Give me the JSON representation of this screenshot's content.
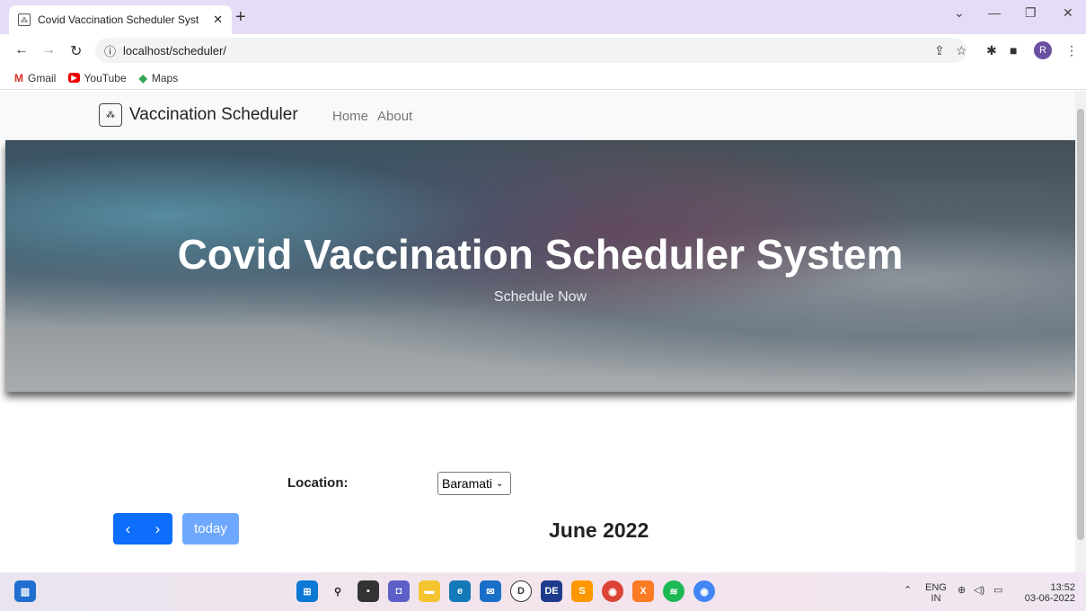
{
  "browser": {
    "tab_title": "Covid Vaccination Scheduler Syst",
    "tab_close": "✕",
    "new_tab": "+",
    "url": "localhost/scheduler/",
    "bookmarks": [
      {
        "label": "Gmail",
        "icon": "M"
      },
      {
        "label": "YouTube",
        "icon": "▶"
      },
      {
        "label": "Maps",
        "icon": "◆"
      }
    ],
    "profile_initial": "R"
  },
  "navbar": {
    "brand": "Vaccination Scheduler",
    "links": [
      "Home",
      "About"
    ]
  },
  "hero": {
    "title": "Covid Vaccination Scheduler System",
    "subtitle": "Schedule Now"
  },
  "form": {
    "location_label": "Location:",
    "location_value": "Baramati"
  },
  "calendar": {
    "prev": "‹",
    "next": "›",
    "today": "today",
    "title": "June 2022"
  },
  "taskbar": {
    "lang_top": "ENG",
    "lang_bottom": "IN",
    "time": "13:52",
    "date": "03-06-2022"
  },
  "colors": {
    "primary": "#0d6efd",
    "primary_light": "#6ea8fe",
    "tabbar": "#e7dcf7"
  }
}
